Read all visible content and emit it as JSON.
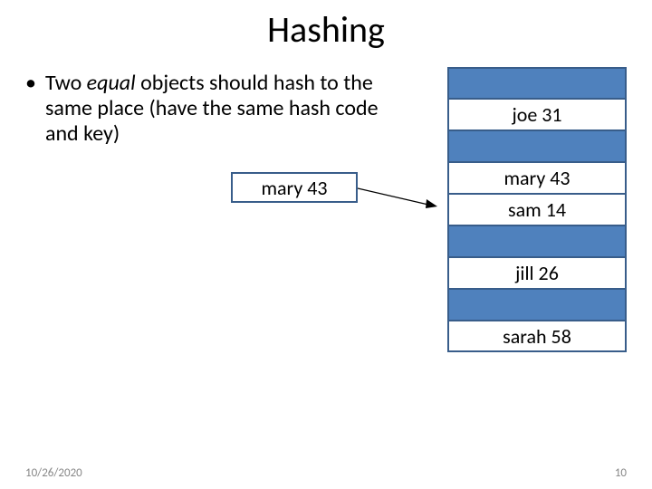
{
  "title": "Hashing",
  "bullet": {
    "prefix": "Two ",
    "equal": "equal",
    "rest": " objects should hash to the same place (have the same hash code and key)"
  },
  "key_item": "mary 43",
  "hash_slots": [
    {
      "label": "",
      "filled": false
    },
    {
      "label": "joe 31",
      "filled": true
    },
    {
      "label": "",
      "filled": false
    },
    {
      "label": "mary 43",
      "filled": true
    },
    {
      "label": "sam 14",
      "filled": true
    },
    {
      "label": "",
      "filled": false
    },
    {
      "label": "jill 26",
      "filled": true
    },
    {
      "label": "",
      "filled": false
    },
    {
      "label": "sarah 58",
      "filled": true
    }
  ],
  "footer": {
    "date": "10/26/2020",
    "page": "10"
  }
}
